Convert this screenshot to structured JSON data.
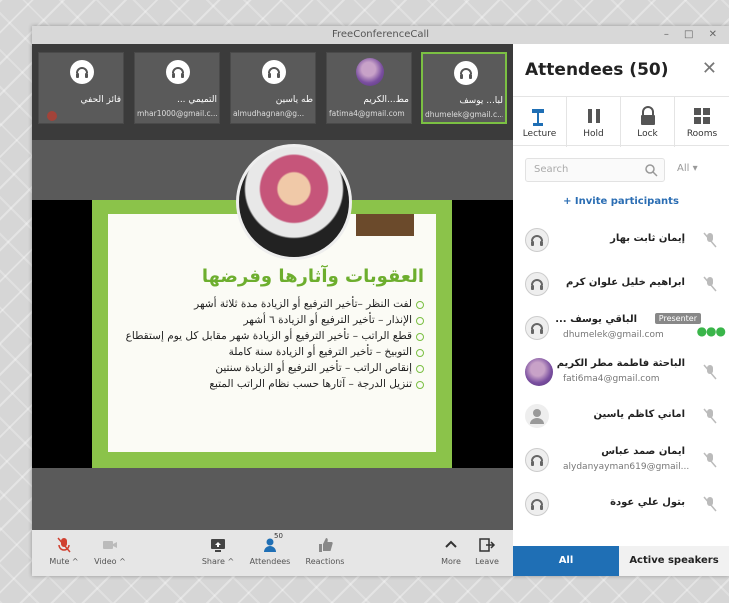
{
  "window": {
    "title": "FreeConferenceCall",
    "controls": "–  □  ✕"
  },
  "thumbnails": [
    {
      "name": "فائز الحفي",
      "email": ""
    },
    {
      "name": "... التميمي",
      "email": "mhar1000@gmail.c..."
    },
    {
      "name": "طه ياسين",
      "email": "almudhagnan@g..."
    },
    {
      "name": "مط...الكريم",
      "email": "fatima4@gmail.com"
    },
    {
      "name": "لبا... يوسف",
      "email": "dhumelek@gmail.c..."
    }
  ],
  "slide": {
    "title": "العقوبات وآثارها وفرضها",
    "bullets": [
      "لفت النظر –تأخير الترفيع أو الزيادة مدة ثلاثة أشهر",
      "الإنذار – تأخير الترفيع أو الزيادة ٦ أشهر",
      "قطع الراتب – تأخير الترفيع أو الزيادة شهر مقابل كل يوم إستقطاع",
      "التوبيخ – تأخير الترفيع أو الزيادة سنة كاملة",
      "إنقاص الراتب – تأخير الترفيع أو الزيادة سنتين",
      "تنزيل الدرجة – آثارها حسب نظام الراتب المتبع"
    ]
  },
  "toolbar": {
    "mute": "Mute ^",
    "video": "Video ^",
    "share": "Share ^",
    "attendees": "Attendees",
    "attendees_count": "50",
    "reactions": "Reactions",
    "more": "More",
    "leave": "Leave"
  },
  "panel": {
    "title": "Attendees (50)",
    "tools": [
      "Lecture",
      "Hold",
      "Lock",
      "Rooms"
    ],
    "search_placeholder": "Search",
    "filter": "All ▾",
    "invite": "+ Invite participants",
    "attendees": [
      {
        "name": "إيمان ثابت بهار",
        "email": ""
      },
      {
        "name": "ابراهيم خليل علوان كرم",
        "email": ""
      },
      {
        "name": "الباقي يوسف ...",
        "email": "dhumelek@gmail.com",
        "badge": "Presenter"
      },
      {
        "name": "الباحثة فاطمة مطر الكريم",
        "email": "fati6ma4@gmail.com"
      },
      {
        "name": "اماني كاظم ياسين",
        "email": ""
      },
      {
        "name": "ايمان صمد عباس",
        "email": "alydanyayman619@gmail..."
      },
      {
        "name": "بتول علي عودة",
        "email": ""
      }
    ],
    "tab_all": "All",
    "tab_active": "Active speakers"
  },
  "colors": {
    "accent": "#1f6fb5",
    "slide_green": "#8bc34a",
    "active_border": "#7bc043"
  }
}
